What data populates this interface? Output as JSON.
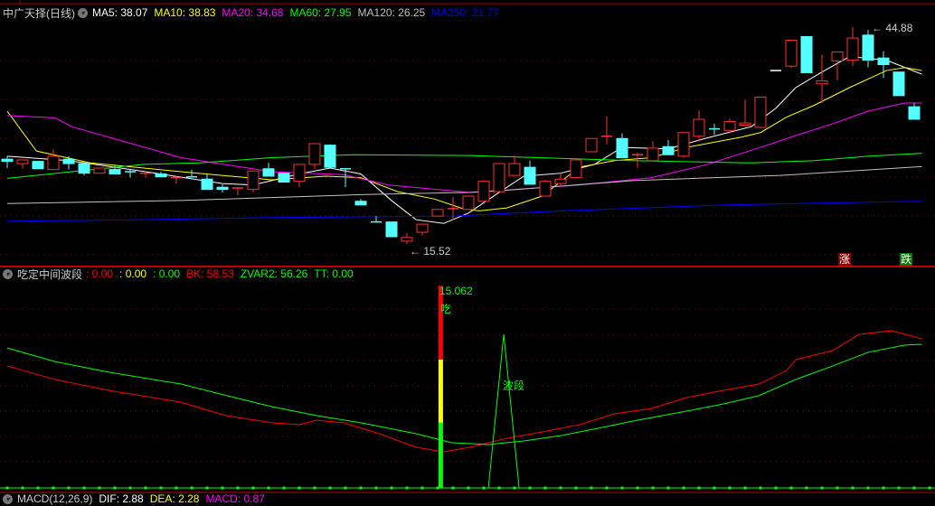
{
  "header": {
    "title": "中广天择(日线)",
    "ma": [
      {
        "label": "MA5: 38.07",
        "color": "#ffffff"
      },
      {
        "label": "MA10: 38.83",
        "color": "#ffff00"
      },
      {
        "label": "MA20: 34.68",
        "color": "#ff00ff"
      },
      {
        "label": "MA60: 27.95",
        "color": "#00ff00"
      },
      {
        "label": "MA120: 26.25",
        "color": "#c0c0c0"
      },
      {
        "label": "MA250: 21.77",
        "color": "#0000ff"
      }
    ]
  },
  "indicator_header": {
    "title": "吃定中间波段",
    "values": [
      {
        "label": ": 0.00",
        "color": "#ff0000"
      },
      {
        "label": ": 0.00",
        "color": "#ffff00"
      },
      {
        "label": ": 0.00",
        "color": "#00ff00"
      },
      {
        "label": "BK: 58.53",
        "color": "#ff0000"
      },
      {
        "label": "ZVAR2: 56.26",
        "color": "#00ff00"
      },
      {
        "label": "TT: 0.00",
        "color": "#00ff00"
      }
    ]
  },
  "macd_header": {
    "title": "MACD(12,26,9)",
    "values": [
      {
        "label": "DIF: 2.88",
        "color": "#ffffff"
      },
      {
        "label": "DEA: 2.28",
        "color": "#ffff00"
      },
      {
        "label": "MACD: 0.87",
        "color": "#ff00ff"
      }
    ]
  },
  "markers": {
    "high_label": "44.88",
    "low_label": "15.52",
    "rise_tag": "涨",
    "fall_tag": "跌"
  },
  "indicator_labels": {
    "peak_value": "15.062",
    "eat": "吃",
    "wave": "波段"
  },
  "colors": {
    "up": "#ff3030",
    "down": "#54ffff",
    "grid": "#8b0000"
  },
  "chart_data": [
    {
      "type": "candlestick",
      "price_range": [
        15.52,
        44.88
      ],
      "candles": [
        [
          27.0,
          26.7,
          27.4,
          25.8
        ],
        [
          26.4,
          26.9,
          26.9,
          25.7
        ],
        [
          26.7,
          25.7,
          26.7,
          25.7
        ],
        [
          25.6,
          27.4,
          28.3,
          25.6
        ],
        [
          27.0,
          26.4,
          27.4,
          25.6
        ],
        [
          26.4,
          25.1,
          26.4,
          24.8
        ],
        [
          25.1,
          25.8,
          25.8,
          25.1
        ],
        [
          25.6,
          25.0,
          26.1,
          25.0
        ],
        [
          25.3,
          25.3,
          25.6,
          24.5
        ],
        [
          25.1,
          25.1,
          25.4,
          24.5
        ],
        [
          25.0,
          24.6,
          25.3,
          24.6
        ],
        [
          24.5,
          24.5,
          24.7,
          23.7
        ],
        [
          24.6,
          24.6,
          25.6,
          24.6
        ],
        [
          24.3,
          22.9,
          25.1,
          22.9
        ],
        [
          23.2,
          22.9,
          23.6,
          22.5
        ],
        [
          23.1,
          23.1,
          23.1,
          22.1
        ],
        [
          22.9,
          25.4,
          25.4,
          22.5
        ],
        [
          25.7,
          24.7,
          26.5,
          24.7
        ],
        [
          25.1,
          23.9,
          25.1,
          23.9
        ],
        [
          24.0,
          26.3,
          26.3,
          23.2
        ],
        [
          26.3,
          29.1,
          29.1,
          25.7
        ],
        [
          28.9,
          25.9,
          29.0,
          25.9
        ],
        [
          25.7,
          25.7,
          25.7,
          23.2
        ],
        [
          21.3,
          20.8,
          21.6,
          20.8
        ],
        [
          18.5,
          18.5,
          19.3,
          18.5
        ],
        [
          18.5,
          16.5,
          18.5,
          16.5
        ],
        [
          15.9,
          16.4,
          17.0,
          15.52
        ],
        [
          17.1,
          18.2,
          18.2,
          16.7
        ],
        [
          19.3,
          20.2,
          20.2,
          19.3
        ],
        [
          20.3,
          20.3,
          21.9,
          18.8
        ],
        [
          20.2,
          22.0,
          22.0,
          20.2
        ],
        [
          21.3,
          24.0,
          24.1,
          21.3
        ],
        [
          22.6,
          26.4,
          26.4,
          22.6
        ],
        [
          24.8,
          26.4,
          27.5,
          24.8
        ],
        [
          25.9,
          23.6,
          26.8,
          23.6
        ],
        [
          22.0,
          24.0,
          24.2,
          22.0
        ],
        [
          23.7,
          24.3,
          25.1,
          23.2
        ],
        [
          24.5,
          26.9,
          26.9,
          24.5
        ],
        [
          28.0,
          29.8,
          29.8,
          28.0
        ],
        [
          30.1,
          30.1,
          32.8,
          29.0
        ],
        [
          29.8,
          27.2,
          30.5,
          27.2
        ],
        [
          27.6,
          27.6,
          27.9,
          25.8
        ],
        [
          26.8,
          28.5,
          29.4,
          26.8
        ],
        [
          28.7,
          27.6,
          29.6,
          27.6
        ],
        [
          27.4,
          30.6,
          30.6,
          27.2
        ],
        [
          30.1,
          32.4,
          33.6,
          29.4
        ],
        [
          31.1,
          31.1,
          31.8,
          30.3
        ],
        [
          30.9,
          32.1,
          32.5,
          30.5
        ],
        [
          31.6,
          31.9,
          35.1,
          31.6
        ],
        [
          31.3,
          35.4,
          35.4,
          31.3
        ],
        [
          39.0,
          39.0,
          39.0,
          39.0
        ],
        [
          39.6,
          43.1,
          43.1,
          39.3
        ],
        [
          43.6,
          38.7,
          43.6,
          38.7
        ],
        [
          37.2,
          37.6,
          41.1,
          34.6
        ],
        [
          40.3,
          41.5,
          41.5,
          37.7
        ],
        [
          40.4,
          43.4,
          44.88,
          39.6
        ],
        [
          43.8,
          40.4,
          44.5,
          39.4
        ],
        [
          40.7,
          39.8,
          41.6,
          38.0
        ],
        [
          38.8,
          35.6,
          38.8,
          35.6
        ],
        [
          34.1,
          32.4,
          34.6,
          32.4
        ]
      ],
      "moving_averages": [
        {
          "name": "MA5",
          "color": "#ffffff",
          "points": [
            [
              1,
              27.4
            ],
            [
              5,
              26.8
            ],
            [
              10,
              25.3
            ],
            [
              15,
              23.7
            ],
            [
              17,
              23.5
            ],
            [
              20,
              25.0
            ],
            [
              22,
              25.8
            ],
            [
              24,
              25.0
            ],
            [
              26,
              21.4
            ],
            [
              27.6,
              18.8
            ],
            [
              29.4,
              18.3
            ],
            [
              31,
              19.7
            ],
            [
              33,
              22.5
            ],
            [
              34.6,
              24.7
            ],
            [
              37,
              25.1
            ],
            [
              39.2,
              26.3
            ],
            [
              41,
              28.6
            ],
            [
              44,
              28.4
            ],
            [
              46.4,
              29.8
            ],
            [
              49.4,
              31.4
            ],
            [
              51,
              33.9
            ],
            [
              52.3,
              36.7
            ],
            [
              54,
              38.8
            ],
            [
              55.8,
              40.9
            ],
            [
              58.2,
              40.4
            ],
            [
              60.5,
              38.5
            ]
          ]
        },
        {
          "name": "MA10",
          "color": "#ffff00",
          "points": [
            [
              1,
              33.5
            ],
            [
              2.9,
              28.1
            ],
            [
              6.4,
              26.5
            ],
            [
              12.3,
              25.3
            ],
            [
              18.2,
              24.2
            ],
            [
              21.7,
              24.7
            ],
            [
              24,
              24.5
            ],
            [
              26.4,
              22.6
            ],
            [
              28.8,
              21.6
            ],
            [
              30.5,
              20.4
            ],
            [
              31.7,
              20.0
            ],
            [
              33.5,
              20.4
            ],
            [
              35.8,
              22.0
            ],
            [
              38.2,
              25.9
            ],
            [
              40.5,
              26.8
            ],
            [
              42.9,
              27.2
            ],
            [
              45.2,
              28.6
            ],
            [
              48.8,
              30.0
            ],
            [
              50,
              30.6
            ],
            [
              51.7,
              32.7
            ],
            [
              53.5,
              34.3
            ],
            [
              55.8,
              36.7
            ],
            [
              58.2,
              39.0
            ],
            [
              59.4,
              39.4
            ],
            [
              60.5,
              39.0
            ]
          ]
        },
        {
          "name": "MA20",
          "color": "#ff00ff",
          "points": [
            [
              1,
              32.9
            ],
            [
              4.1,
              32.6
            ],
            [
              5.2,
              31.4
            ],
            [
              12.3,
              27.2
            ],
            [
              18.2,
              25.3
            ],
            [
              22.9,
              24.9
            ],
            [
              25.8,
              23.5
            ],
            [
              31.1,
              22.5
            ],
            [
              38.2,
              23.5
            ],
            [
              42.9,
              24.5
            ],
            [
              46.4,
              26.2
            ],
            [
              50,
              28.6
            ],
            [
              52.3,
              30.2
            ],
            [
              54.7,
              31.8
            ],
            [
              57,
              33.5
            ],
            [
              59.4,
              34.6
            ],
            [
              60.5,
              34.6
            ]
          ]
        },
        {
          "name": "MA60",
          "color": "#00ff00",
          "points": [
            [
              1,
              24.4
            ],
            [
              5.2,
              25.3
            ],
            [
              9.9,
              26.3
            ],
            [
              13.5,
              26.5
            ],
            [
              18.2,
              27.2
            ],
            [
              23.5,
              27.6
            ],
            [
              31.1,
              27.5
            ],
            [
              41.7,
              26.8
            ],
            [
              49.4,
              26.5
            ],
            [
              53.5,
              26.8
            ],
            [
              57,
              27.4
            ],
            [
              60.5,
              27.8
            ]
          ]
        },
        {
          "name": "MA120",
          "color": "#c0c0c0",
          "points": [
            [
              1,
              21.0
            ],
            [
              12.3,
              21.4
            ],
            [
              24,
              22.2
            ],
            [
              31.1,
              22.5
            ],
            [
              33.5,
              22.8
            ],
            [
              41.7,
              24.1
            ],
            [
              51.3,
              24.8
            ],
            [
              60.5,
              26.0
            ]
          ]
        },
        {
          "name": "MA250",
          "color": "#0000ff",
          "points": [
            [
              1,
              18.6
            ],
            [
              9.4,
              18.8
            ],
            [
              18.2,
              19.1
            ],
            [
              30,
              19.3
            ],
            [
              37,
              20.0
            ],
            [
              47.6,
              20.8
            ],
            [
              60.5,
              21.3
            ]
          ]
        }
      ]
    },
    {
      "type": "line",
      "title": "吃定中间波段",
      "y_range": [
        0,
        100
      ],
      "series": [
        {
          "name": "BK",
          "color": "#ff0000",
          "points": [
            [
              1,
              50.4
            ],
            [
              4.1,
              44.8
            ],
            [
              7.6,
              40.3
            ],
            [
              12.3,
              35.4
            ],
            [
              15.2,
              29.9
            ],
            [
              18.2,
              26.9
            ],
            [
              20,
              26.1
            ],
            [
              21.1,
              28.0
            ],
            [
              22.9,
              26.9
            ],
            [
              25.2,
              22.4
            ],
            [
              27.6,
              16.8
            ],
            [
              29.4,
              14.9
            ],
            [
              31.1,
              16.8
            ],
            [
              33.5,
              20.5
            ],
            [
              35.8,
              23.1
            ],
            [
              38.2,
              26.1
            ],
            [
              40.5,
              30.6
            ],
            [
              42.9,
              32.8
            ],
            [
              45.2,
              37.3
            ],
            [
              47.6,
              40.3
            ],
            [
              49.9,
              42.9
            ],
            [
              51.7,
              48.5
            ],
            [
              52.3,
              53.0
            ],
            [
              54.7,
              56.7
            ],
            [
              56.4,
              63.4
            ],
            [
              58.5,
              64.9
            ],
            [
              60.5,
              61.6
            ]
          ]
        },
        {
          "name": "ZVAR2",
          "color": "#00ff00",
          "points": [
            [
              1,
              57.8
            ],
            [
              4.1,
              52.2
            ],
            [
              7.6,
              47.8
            ],
            [
              12.3,
              42.9
            ],
            [
              15.8,
              37.3
            ],
            [
              18.2,
              33.6
            ],
            [
              21.1,
              29.9
            ],
            [
              24,
              26.9
            ],
            [
              27.6,
              22.4
            ],
            [
              29.9,
              18.7
            ],
            [
              32.3,
              17.9
            ],
            [
              34.6,
              19.4
            ],
            [
              37,
              21.6
            ],
            [
              39.4,
              24.6
            ],
            [
              41.7,
              27.6
            ],
            [
              45.2,
              31.7
            ],
            [
              47.6,
              34.7
            ],
            [
              49.9,
              38.1
            ],
            [
              52.3,
              44.8
            ],
            [
              54.7,
              50.4
            ],
            [
              57,
              56.0
            ],
            [
              59.4,
              59.0
            ],
            [
              60.5,
              59.3
            ]
          ]
        }
      ],
      "signal_bar": {
        "index": 29.2,
        "segments": [
          {
            "color": "#00ff00",
            "to": 26.9
          },
          {
            "color": "#ffff00",
            "to": 53.0
          },
          {
            "color": "#ff0000",
            "to": 83.5
          }
        ]
      },
      "wave_spike": {
        "index": 33.3,
        "height": 63.4,
        "half_width": 1
      }
    }
  ]
}
